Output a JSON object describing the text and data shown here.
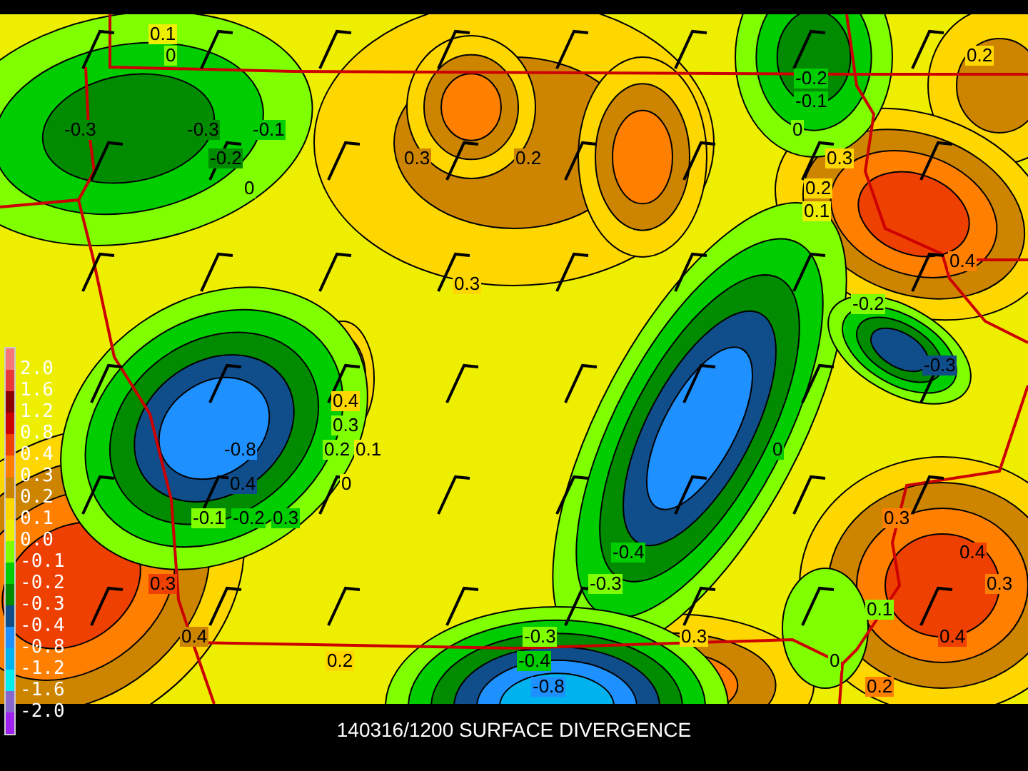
{
  "title": "140316/1200 SURFACE DIVERGENCE",
  "legend": {
    "swatches": [
      {
        "color": "#f87878"
      },
      {
        "color": "#e83838"
      },
      {
        "color": "#8b0000"
      },
      {
        "color": "#cd0000"
      },
      {
        "color": "#ee4000"
      },
      {
        "color": "#ff7f00"
      },
      {
        "color": "#cd8500"
      },
      {
        "color": "#ffd700"
      },
      {
        "color": "#eeee00"
      },
      {
        "color": "#7fff00"
      },
      {
        "color": "#00cd00"
      },
      {
        "color": "#008b00"
      },
      {
        "color": "#104e8b"
      },
      {
        "color": "#1e90ff"
      },
      {
        "color": "#00b2ee"
      },
      {
        "color": "#00eeee"
      },
      {
        "color": "#8968cd"
      },
      {
        "color": "#a020f0"
      }
    ],
    "labels": [
      "2.0",
      "1.6",
      "1.2",
      "0.8",
      "0.4",
      "0.3",
      "0.2",
      "0.1",
      "0.0",
      "-0.1",
      "-0.2",
      "-0.3",
      "-0.4",
      "-0.8",
      "-1.2",
      "-1.6",
      "-2.0"
    ]
  },
  "contour_labels": [
    {
      "text": "0.1"
    },
    {
      "text": "0"
    },
    {
      "text": "0.2"
    },
    {
      "text": "-0.2"
    },
    {
      "text": "-0.1"
    },
    {
      "text": "-0.3"
    },
    {
      "text": "-0.3"
    },
    {
      "text": "-0.1"
    },
    {
      "text": "0"
    },
    {
      "text": "-0.2"
    },
    {
      "text": "0.3"
    },
    {
      "text": "0.2"
    },
    {
      "text": "0.3"
    },
    {
      "text": "0"
    },
    {
      "text": "0.2"
    },
    {
      "text": "0.1"
    },
    {
      "text": "0.4"
    },
    {
      "text": "0.3"
    },
    {
      "text": "-0.2"
    },
    {
      "text": "-0.3"
    },
    {
      "text": "0.4"
    },
    {
      "text": "0.3"
    },
    {
      "text": "-0.8"
    },
    {
      "text": "0.2"
    },
    {
      "text": "0.1"
    },
    {
      "text": "0"
    },
    {
      "text": "0.4"
    },
    {
      "text": "0"
    },
    {
      "text": "-0.1"
    },
    {
      "text": "-0.2"
    },
    {
      "text": "0.3"
    },
    {
      "text": "0.3"
    },
    {
      "text": "-0.4"
    },
    {
      "text": "0.4"
    },
    {
      "text": "0.3"
    },
    {
      "text": "-0.3"
    },
    {
      "text": "0.3"
    },
    {
      "text": "0.1"
    },
    {
      "text": "0.4"
    },
    {
      "text": "-0.3"
    },
    {
      "text": "0.3"
    },
    {
      "text": "0.4"
    },
    {
      "text": "0.2"
    },
    {
      "text": "-0.4"
    },
    {
      "text": "0"
    },
    {
      "text": "-0.8"
    },
    {
      "text": "0.2"
    }
  ]
}
